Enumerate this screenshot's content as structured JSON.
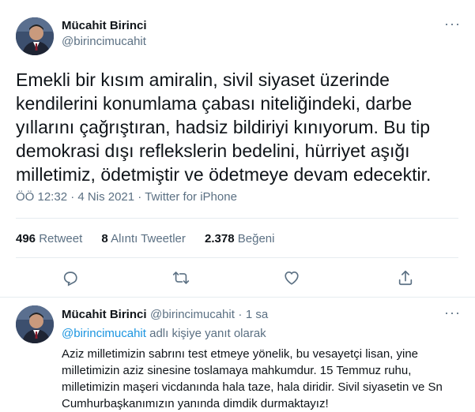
{
  "tweet": {
    "author_name": "Mücahit Birinci",
    "author_handle": "@birincimucahit",
    "more": "···",
    "lines": [
      "Emekli bir kısım amiralin, sivil siyaset üzerinde",
      "kendilerini konumlama çabası niteliğindeki, darbe",
      "yıllarını çağrıştıran, hadsiz bildiriyi kınıyorum. Bu tip",
      "demokrasi dışı reflekslerin bedelini, hürriyet aşığı",
      "milletimiz, ödetmiştir ve ödetmeye devam edecektir."
    ],
    "time": "ÖÖ 12:32",
    "date": "4 Nis 2021",
    "source": "Twitter for iPhone",
    "separator": "·",
    "stats": {
      "retweets_count": "496",
      "retweets_label": "Retweet",
      "quotes_count": "8",
      "quotes_label": "Alıntı Tweetler",
      "likes_count": "2.378",
      "likes_label": "Beğeni"
    },
    "action_icons": [
      "reply-icon",
      "retweet-icon",
      "like-icon",
      "share-icon"
    ]
  },
  "reply": {
    "author_name": "Mücahit Birinci",
    "author_handle": "@birincimucahit",
    "time_ago": "1 sa",
    "separator": "·",
    "more": "···",
    "replying_to_handle": "@birincimucahit",
    "replying_to_suffix": "adlı kişiye yanıt olarak",
    "lines": [
      "Aziz milletimizin sabrını test etmeye yönelik, bu vesayetçi lisan, yine",
      "milletimizin aziz sinesine toslamaya mahkumdur. 15 Temmuz ruhu,",
      "milletimizin maşeri vicdanında hala taze, hala diridir. Sivil siyasetin ve Sn",
      "Cumhurbaşkanımızın yanında dimdik durmaktayız!"
    ]
  },
  "colors": {
    "accent": "#1b95e0",
    "muted": "#5b7083",
    "text": "#0f1419",
    "divider": "#e6ecf0"
  }
}
